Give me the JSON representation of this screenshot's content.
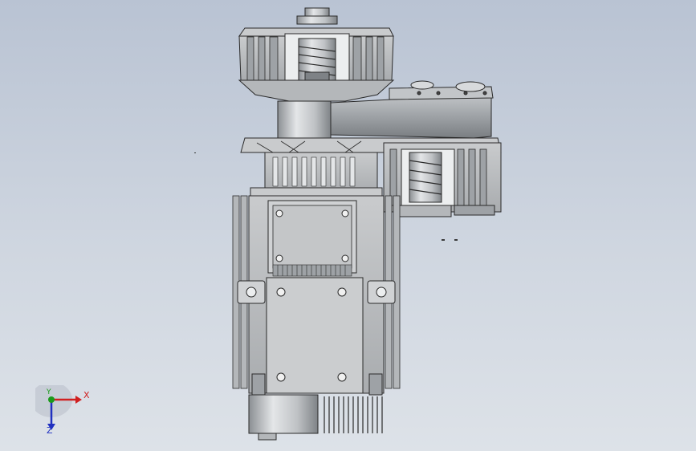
{
  "viewport": {
    "background_top": "#b9c3d3",
    "background_bottom": "#dde2e8"
  },
  "model": {
    "metal_light": "#d8dadc",
    "metal_mid": "#b4b7ba",
    "metal_dark": "#7e8286",
    "edge": "#2a2a2a"
  },
  "triad": {
    "x_label": "X",
    "y_label": "Y",
    "z_label": "Z",
    "x_color": "#d02020",
    "y_color": "#1a9a1a",
    "z_color": "#2030c0"
  }
}
